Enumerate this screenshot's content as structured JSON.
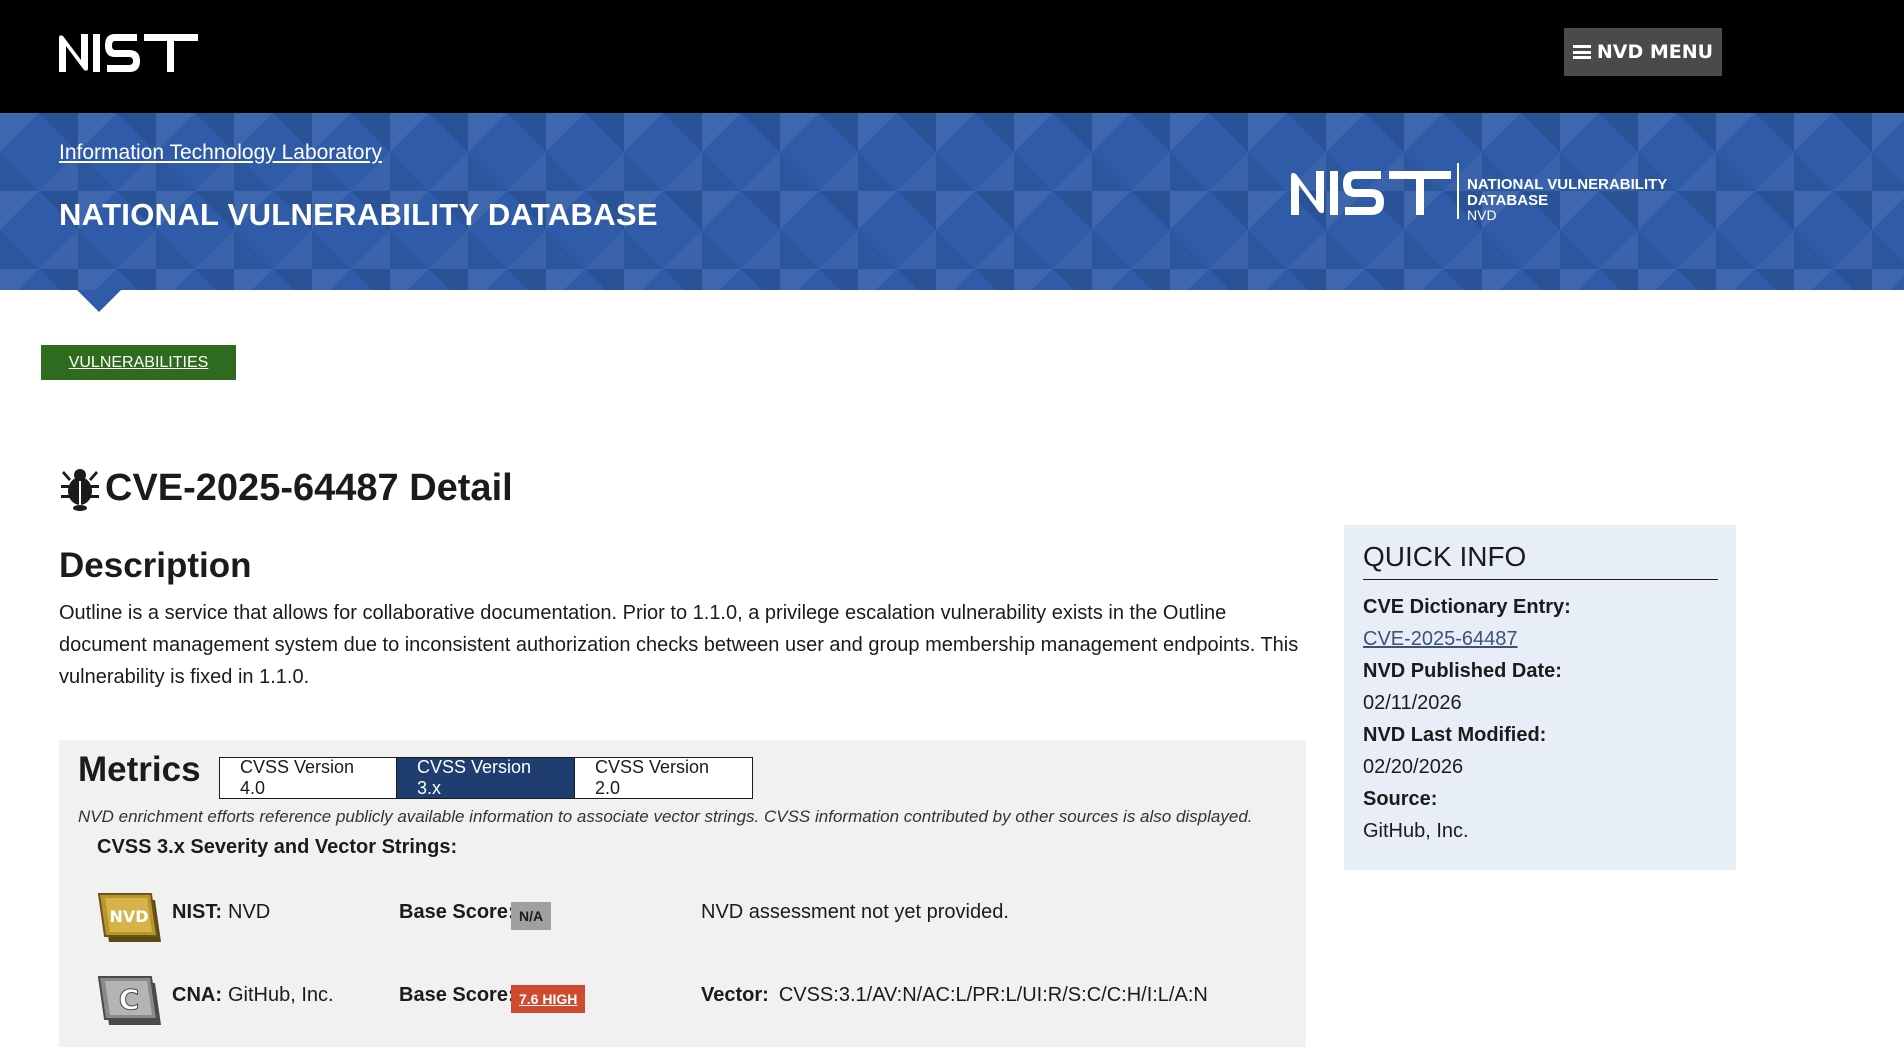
{
  "header": {
    "logo_text": "NIST",
    "menu_label": "NVD MENU",
    "menu_icon": "hamburger-icon"
  },
  "banner": {
    "lab_link": "Information Technology Laboratory",
    "title": "NATIONAL VULNERABILITY DATABASE",
    "logo_lines": [
      "NATIONAL VULNERABILITY",
      "DATABASE",
      "NVD"
    ]
  },
  "breadcrumb": {
    "label": "VULNERABILITIES"
  },
  "page": {
    "title": "CVE-2025-64487 Detail",
    "title_icon": "bug-icon"
  },
  "description": {
    "heading": "Description",
    "text": "Outline is a service that allows for collaborative documentation. Prior to 1.1.0, a privilege escalation vulnerability exists in the Outline document management system due to inconsistent authorization checks between user and group membership management endpoints. This vulnerability is fixed in 1.1.0."
  },
  "metrics": {
    "heading": "Metrics",
    "tabs": [
      {
        "label": "CVSS Version 4.0",
        "active": false
      },
      {
        "label": "CVSS Version 3.x",
        "active": true
      },
      {
        "label": "CVSS Version 2.0",
        "active": false
      }
    ],
    "note": "NVD enrichment efforts reference publicly available information to associate vector strings. CVSS information contributed by other sources is also displayed.",
    "vector_heading": "CVSS 3.x Severity and Vector Strings:",
    "rows": [
      {
        "badge": "NVD",
        "source_label": "NIST:",
        "source_value": "NVD",
        "score_label": "Base Score:",
        "score": "N/A",
        "assessment_label": "",
        "assessment": "NVD assessment not yet provided."
      },
      {
        "badge": "C",
        "source_label": "CNA:",
        "source_value": "GitHub, Inc.",
        "score_label": "Base Score:",
        "score": "7.6 HIGH",
        "assessment_label": "Vector:",
        "assessment": "CVSS:3.1/AV:N/AC:L/PR:L/UI:R/S:C/C:H/I:L/A:N"
      }
    ]
  },
  "quick_info": {
    "heading": "QUICK INFO",
    "dictionary_label": "CVE Dictionary Entry:",
    "dictionary_value": "CVE-2025-64487",
    "published_label": "NVD Published Date:",
    "published_value": "02/11/2026",
    "modified_label": "NVD Last Modified:",
    "modified_value": "02/20/2026",
    "source_label": "Source:",
    "source_value": "GitHub, Inc."
  },
  "colors": {
    "banner_blue": "#2f5ba8",
    "breadcrumb_green": "#2e6b1f",
    "active_tab": "#1f3d6e",
    "high_severity": "#d04a2f",
    "na_severity": "#a0a0a0",
    "quick_info_bg": "#e8eef7"
  }
}
